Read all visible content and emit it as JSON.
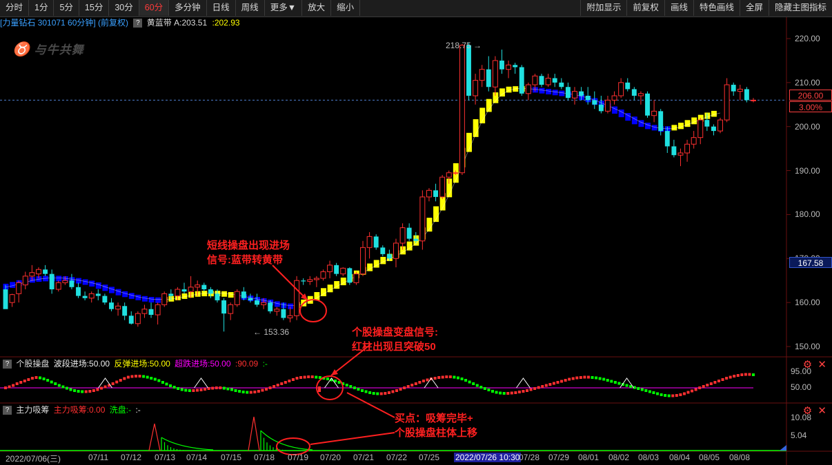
{
  "toolbar": {
    "periods": [
      "分时",
      "1分",
      "5分",
      "15分",
      "30分",
      "60分",
      "多分钟",
      "日线",
      "周线",
      "更多▼",
      "放大",
      "缩小"
    ],
    "active_period": "60分",
    "right_buttons": [
      "附加显示",
      "前复权",
      "画线",
      "特色画线",
      "全屏",
      "隐藏主图指标"
    ]
  },
  "header": {
    "stock_info": "[力量钻石 301071 60分钟] (前复权)",
    "indicator_name": "黄蓝带",
    "indicator_a": "A:203.51",
    "indicator_b": ":202.93",
    "watermark": "与牛共舞"
  },
  "main_axis": {
    "ticks": [
      "220.00",
      "210.00",
      "200.00",
      "190.00",
      "180.00",
      "170.00",
      "160.00",
      "150.00"
    ],
    "current_price": "206.00",
    "change_pct": "3.00%",
    "cursor_price": "167.58",
    "high_label": "218.75",
    "low_label": "153.36"
  },
  "pane1": {
    "name": "个股操盘",
    "legend_1": "波段进场:50.00",
    "legend_2": "反弹进场:50.00",
    "legend_3": "超跌进场:50.00",
    "legend_4": ":90.09",
    "legend_5": ":-",
    "ticks": [
      "95.00",
      "50.00"
    ]
  },
  "pane2": {
    "name": "主力吸筹",
    "legend_1": "主力吸筹:0.00",
    "legend_2": "洗盘:-",
    "legend_3": ":-",
    "ticks": [
      "10.08",
      "5.04"
    ]
  },
  "dates": [
    "2022/07/06(三)",
    "07/11",
    "07/12",
    "07/13",
    "07/14",
    "07/15",
    "07/18",
    "07/19",
    "07/20",
    "07/21",
    "07/22",
    "07/25",
    "2022/07/26 10:30",
    "07/28",
    "07/29",
    "08/01",
    "08/02",
    "08/03",
    "08/04",
    "08/05",
    "08/08"
  ],
  "annotations": {
    "a1_line1": "短线操盘出现进场",
    "a1_line2": "信号:蓝带转黄带",
    "a2_line1": "个股操盘变盘信号:",
    "a2_line2": "红柱出现且突破50",
    "a3_line1": "买点：吸筹完毕+",
    "a3_line2": "个股操盘柱体上移"
  },
  "colors": {
    "up": "#ff3030",
    "down": "#20e0e0",
    "yellow_band": "#ffff00",
    "blue_band": "#0000ff",
    "purple_line": "#ff00ff",
    "green": "#00ff00",
    "annotation": "#ff2020",
    "date_highlight": "#2020a0"
  },
  "chart_data": {
    "type": "candlestick",
    "ylim": [
      148,
      222
    ],
    "candles": [
      [
        163,
        164,
        159,
        158.5
      ],
      [
        160,
        162,
        159,
        161.8
      ],
      [
        162,
        165,
        160,
        164.5
      ],
      [
        164,
        167,
        163,
        166
      ],
      [
        166,
        168.5,
        165,
        166.8
      ],
      [
        166.5,
        168,
        165.5,
        167.5
      ],
      [
        167.5,
        168.5,
        166,
        166.5
      ],
      [
        166.5,
        167.5,
        162,
        163
      ],
      [
        163,
        165,
        162.5,
        164.5
      ],
      [
        164.5,
        166,
        164,
        165
      ],
      [
        165,
        166.5,
        163,
        163.5
      ],
      [
        163.5,
        164.5,
        161,
        161.5
      ],
      [
        161.5,
        162.5,
        160.5,
        161
      ],
      [
        161,
        162.5,
        160,
        162
      ],
      [
        162,
        163,
        160.5,
        161.5
      ],
      [
        161.5,
        162,
        159.5,
        160
      ],
      [
        160,
        161,
        158,
        158.5
      ],
      [
        158.5,
        160,
        157,
        159.2
      ],
      [
        159.2,
        160,
        156,
        157
      ],
      [
        157,
        158,
        155,
        155.2
      ],
      [
        155.2,
        158,
        154.5,
        157.5
      ],
      [
        157.5,
        159.5,
        156.5,
        158.5
      ],
      [
        158.5,
        160,
        156.5,
        157.2
      ],
      [
        157.2,
        160,
        155,
        159.5
      ],
      [
        159.5,
        162.5,
        159,
        162
      ],
      [
        162,
        163,
        160.5,
        161.5
      ],
      [
        161.5,
        163.5,
        160.5,
        163
      ],
      [
        163,
        164.5,
        162,
        162.5
      ],
      [
        162.5,
        166,
        161,
        163.5
      ],
      [
        163.5,
        165,
        161.5,
        164
      ],
      [
        164,
        164.5,
        162.5,
        163
      ],
      [
        163,
        163.5,
        161,
        162
      ],
      [
        162,
        163,
        160,
        160.5
      ],
      [
        160.5,
        161,
        153.4,
        157.5
      ],
      [
        157.5,
        160,
        156,
        159.5
      ],
      [
        159.5,
        163,
        159,
        162.5
      ],
      [
        162.5,
        163.5,
        160.5,
        161
      ],
      [
        161,
        162,
        160,
        160.5
      ],
      [
        160.5,
        162,
        159,
        159.5
      ],
      [
        159.5,
        161,
        158.5,
        160
      ],
      [
        160,
        160.5,
        157.5,
        158
      ],
      [
        158,
        159,
        157,
        158.5
      ],
      [
        158.5,
        160,
        156,
        156.5
      ],
      [
        156.5,
        159,
        155.5,
        157
      ],
      [
        157,
        166,
        156,
        165
      ],
      [
        165,
        165.5,
        164,
        164.8
      ],
      [
        164.8,
        166,
        164,
        165.2
      ],
      [
        165.2,
        166,
        163.5,
        165.5
      ],
      [
        165.5,
        167.5,
        165,
        167
      ],
      [
        167,
        169.5,
        165.5,
        168.5
      ],
      [
        168.5,
        169,
        166,
        166.5
      ],
      [
        166.5,
        168,
        166,
        167.8
      ],
      [
        167.8,
        168,
        164,
        164.5
      ],
      [
        164.5,
        167,
        164,
        166.5
      ],
      [
        166.5,
        174,
        166,
        172.5
      ],
      [
        172.5,
        176,
        170,
        175
      ],
      [
        175,
        175.5,
        172,
        172.5
      ],
      [
        172.5,
        173,
        170.5,
        171
      ],
      [
        171,
        172,
        169.5,
        170
      ],
      [
        170,
        174.5,
        168,
        173.5
      ],
      [
        173.5,
        178,
        172,
        177
      ],
      [
        177,
        178,
        174,
        174.5
      ],
      [
        174.5,
        176,
        173.5,
        174
      ],
      [
        174,
        185.5,
        172,
        184
      ],
      [
        184,
        186,
        183,
        185.5
      ],
      [
        185.5,
        187,
        183,
        184
      ],
      [
        184,
        189,
        183.5,
        188.5
      ],
      [
        188.5,
        190,
        187,
        189.5
      ],
      [
        189.5,
        190,
        189,
        189.5
      ],
      [
        189.5,
        218.75,
        189,
        218.5
      ],
      [
        218.5,
        219,
        206,
        207
      ],
      [
        207,
        212,
        205,
        210.5
      ],
      [
        210.5,
        214,
        209,
        213
      ],
      [
        213,
        216,
        208,
        209
      ],
      [
        209,
        216,
        207,
        215
      ],
      [
        215,
        217.5,
        212,
        213
      ],
      [
        213,
        215,
        211,
        214
      ],
      [
        214,
        214.5,
        212,
        213.5
      ],
      [
        213.5,
        214,
        207,
        207.5
      ],
      [
        207.5,
        210,
        206,
        209.5
      ],
      [
        209.5,
        212,
        208,
        211.5
      ],
      [
        211.5,
        212,
        209,
        209.5
      ],
      [
        209.5,
        212,
        209,
        211
      ],
      [
        211,
        212,
        209,
        210
      ],
      [
        210,
        211,
        208.5,
        209
      ],
      [
        209,
        210,
        206,
        206.5
      ],
      [
        206.5,
        209,
        205,
        208
      ],
      [
        208,
        209,
        206,
        207
      ],
      [
        207,
        209,
        205,
        206
      ],
      [
        206,
        208,
        204,
        205
      ],
      [
        205,
        207,
        203,
        203.5
      ],
      [
        203.5,
        207,
        203,
        206
      ],
      [
        206,
        208,
        205,
        207
      ],
      [
        207,
        211,
        206.5,
        210
      ],
      [
        210,
        211,
        208,
        208.5
      ],
      [
        208.5,
        209,
        206,
        207
      ],
      [
        207,
        208,
        205,
        207.5
      ],
      [
        207.5,
        208,
        202,
        202.5
      ],
      [
        202.5,
        206,
        201,
        203.5
      ],
      [
        203.5,
        204,
        198,
        199
      ],
      [
        199,
        200,
        194,
        195.5
      ],
      [
        195.5,
        197,
        193,
        193.5
      ],
      [
        193.5,
        195,
        191,
        194
      ],
      [
        194,
        197,
        192,
        196
      ],
      [
        196,
        199,
        195,
        197.5
      ],
      [
        197.5,
        202,
        196,
        201.5
      ],
      [
        201.5,
        203,
        199,
        200
      ],
      [
        200,
        200.5,
        198,
        199
      ],
      [
        199,
        202,
        198.5,
        201.5
      ],
      [
        201.5,
        211,
        201,
        209.5
      ],
      [
        209.5,
        210,
        207,
        208
      ],
      [
        208,
        209.5,
        206,
        208.5
      ],
      [
        208.5,
        209,
        205.5,
        206
      ],
      [
        206,
        206.5,
        205.5,
        206
      ]
    ],
    "band": [
      163.5,
      163.8,
      164.2,
      164.6,
      165,
      165.3,
      165.5,
      165.6,
      165.6,
      165.5,
      165.3,
      165.1,
      164.8,
      164.5,
      164.1,
      163.6,
      163.1,
      162.6,
      162.1,
      161.7,
      161.3,
      161,
      160.8,
      160.7,
      160.7,
      160.8,
      161,
      161.3,
      161.6,
      161.9,
      162.1,
      162.2,
      162.2,
      162.1,
      161.9,
      161.7,
      161.4,
      161.1,
      160.8,
      160.5,
      160.2,
      159.8,
      159.5,
      159.3,
      159.3,
      159.6,
      160.2,
      161,
      161.9,
      162.8,
      163.6,
      164.4,
      165.2,
      166,
      166.8,
      167.6,
      168.4,
      169.2,
      169.9,
      170.6,
      171.4,
      172.3,
      173.4,
      174.8,
      176.6,
      178.8,
      181.4,
      184.4,
      187.7,
      191.2,
      194.7,
      198.1,
      201.2,
      203.8,
      205.8,
      207.3,
      208.2,
      208.6,
      208.7,
      208.6,
      208.5,
      208.3,
      208.1,
      207.9,
      207.7,
      207.5,
      207.2,
      206.9,
      206.5,
      206,
      205.4,
      204.8,
      204.1,
      203.4,
      202.6,
      201.8,
      201,
      200.4,
      199.9,
      199.6,
      199.5,
      199.6,
      199.9,
      200.4,
      201,
      201.6,
      202.2,
      202.7,
      203.1
    ],
    "band_blue": [
      1,
      1,
      1,
      1,
      1,
      1,
      1,
      1,
      1,
      1,
      1,
      1,
      1,
      1,
      1,
      1,
      1,
      1,
      1,
      1,
      1,
      1,
      1,
      1,
      0,
      0,
      0,
      0,
      0,
      0,
      0,
      0,
      0,
      0,
      0,
      1,
      1,
      1,
      1,
      1,
      1,
      1,
      1,
      1,
      0,
      0,
      0,
      0,
      0,
      0,
      0,
      0,
      0,
      0,
      0,
      0,
      0,
      0,
      0,
      0,
      0,
      0,
      0,
      0,
      0,
      0,
      0,
      0,
      0,
      0,
      0,
      0,
      0,
      0,
      0,
      0,
      0,
      0,
      0,
      1,
      1,
      1,
      1,
      1,
      1,
      1,
      1,
      1,
      1,
      1,
      1,
      1,
      1,
      1,
      1,
      1,
      1,
      1,
      1,
      1,
      1,
      0,
      0,
      0,
      0,
      0,
      0,
      0,
      0
    ],
    "pane1_series": [
      50,
      53,
      57,
      62,
      66,
      70,
      74,
      78,
      80,
      79,
      76,
      72,
      67,
      62,
      57,
      53,
      49,
      45,
      42,
      40,
      39,
      39,
      40,
      42,
      45,
      49,
      53,
      57,
      62,
      67,
      72,
      77,
      81,
      83,
      84,
      84,
      83,
      81,
      78,
      75,
      71,
      66,
      61,
      56,
      52,
      48,
      45,
      43,
      42,
      42,
      43,
      44,
      46,
      48,
      49,
      50,
      50,
      49,
      47,
      45,
      42,
      40,
      38,
      37,
      37,
      38,
      40,
      43,
      46,
      50,
      54,
      58,
      62,
      66,
      70,
      74,
      78,
      80,
      81,
      82,
      82,
      81,
      80,
      78,
      76,
      73,
      70,
      66,
      62,
      58,
      54,
      50,
      46,
      42,
      39,
      36,
      34,
      33,
      33,
      34,
      36,
      39,
      42,
      46,
      50,
      54,
      58,
      62,
      66,
      70,
      73,
      76,
      78,
      80,
      81,
      82,
      82,
      81,
      79,
      76,
      72,
      67,
      62,
      57,
      52,
      48,
      44,
      40,
      37,
      35,
      34,
      34,
      35,
      36,
      38,
      40,
      42,
      45,
      48,
      51,
      54,
      57,
      60,
      63,
      66,
      69,
      72,
      75,
      77,
      79,
      80,
      81,
      81,
      80,
      79,
      77,
      75,
      72,
      69,
      66,
      63,
      60,
      57,
      54,
      51,
      48,
      45,
      42,
      39,
      36,
      33,
      30,
      28,
      27,
      27,
      28,
      30,
      33,
      37,
      41,
      45,
      50,
      54,
      58,
      62,
      66,
      70,
      74,
      78,
      81,
      84,
      86,
      88,
      89,
      89,
      88
    ],
    "pane1_triangles": [
      26,
      51,
      85,
      111,
      135,
      162,
      350,
      375,
      545,
      558,
      617
    ]
  }
}
